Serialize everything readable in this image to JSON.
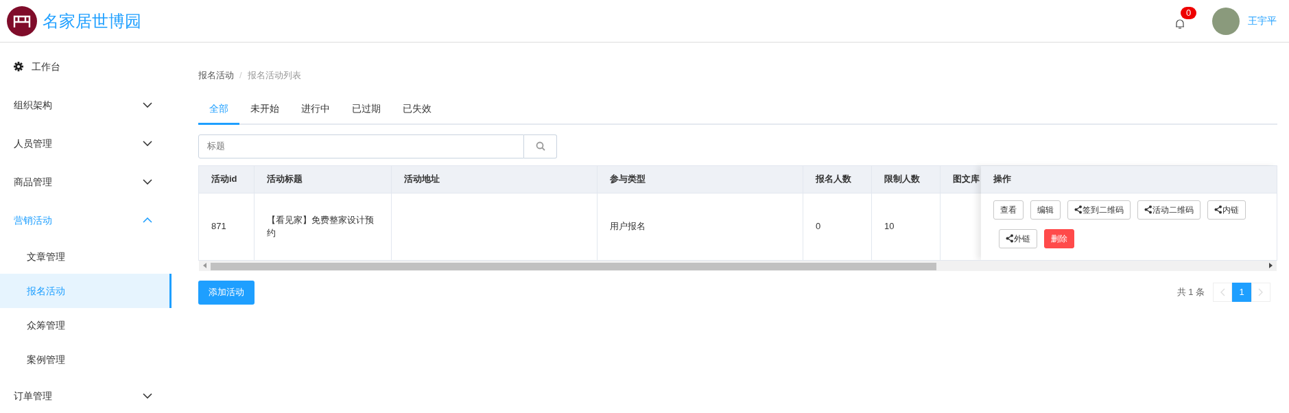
{
  "header": {
    "title": "名家居世博园",
    "notifications": {
      "count": "0"
    },
    "user": {
      "name": "王宇平"
    }
  },
  "sidebar": {
    "items": [
      {
        "kind": "dashboard",
        "label": "工作台",
        "selected": false
      },
      {
        "kind": "group",
        "label": "组织架构",
        "expanded": false,
        "selected": false
      },
      {
        "kind": "group",
        "label": "人员管理",
        "expanded": false,
        "selected": false
      },
      {
        "kind": "group",
        "label": "商品管理",
        "expanded": false,
        "selected": false
      },
      {
        "kind": "group",
        "label": "营销活动",
        "expanded": true,
        "selected": true,
        "children": [
          {
            "label": "文章管理",
            "selected": false
          },
          {
            "label": "报名活动",
            "selected": true
          },
          {
            "label": "众筹管理",
            "selected": false
          },
          {
            "label": "案例管理",
            "selected": false
          }
        ]
      },
      {
        "kind": "group",
        "label": "订单管理",
        "expanded": false,
        "selected": false
      }
    ]
  },
  "breadcrumb": {
    "separator": "/",
    "items": [
      "报名活动",
      "报名活动列表"
    ]
  },
  "tabs": [
    {
      "label": "全部",
      "selected": true
    },
    {
      "label": "未开始",
      "selected": false
    },
    {
      "label": "进行中",
      "selected": false
    },
    {
      "label": "已过期",
      "selected": false
    },
    {
      "label": "已失效",
      "selected": false
    }
  ],
  "search": {
    "placeholder": "标题"
  },
  "table": {
    "columns": [
      "活动id",
      "活动标题",
      "活动地址",
      "参与类型",
      "报名人数",
      "限制人数",
      "图文库"
    ],
    "actions_column": "操作",
    "rows": [
      {
        "cells": [
          "871",
          "【看见家】免费整家设计预约",
          "",
          "用户报名",
          "0",
          "10",
          ""
        ],
        "actions": [
          {
            "kind": "plain",
            "label": "查看"
          },
          {
            "kind": "plain",
            "label": "编辑"
          },
          {
            "kind": "share",
            "label": "签到二维码"
          },
          {
            "kind": "share",
            "label": "活动二维码"
          },
          {
            "kind": "share",
            "label": "内链"
          },
          {
            "kind": "share",
            "label": "外链"
          },
          {
            "kind": "danger",
            "label": "删除"
          }
        ]
      }
    ]
  },
  "add_button": "添加活动",
  "pagination": {
    "total": "共 1 条",
    "pages": [
      {
        "label": "1",
        "selected": true
      }
    ]
  }
}
